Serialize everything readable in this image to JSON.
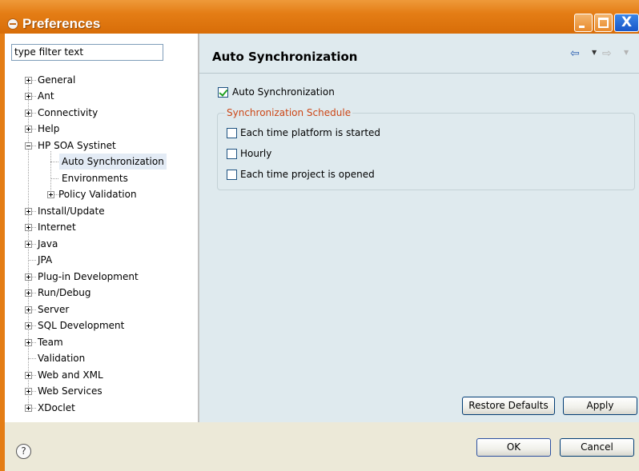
{
  "window": {
    "title": "Preferences",
    "minimize_glyph": "_",
    "maximize_glyph": "□",
    "close_glyph": "X",
    "accent_color": "#e47d15"
  },
  "filter": {
    "value": "type filter text"
  },
  "tree": {
    "items": [
      {
        "label": "General"
      },
      {
        "label": "Ant"
      },
      {
        "label": "Connectivity"
      },
      {
        "label": "Help"
      },
      {
        "label": "HP SOA Systinet"
      },
      {
        "label": "Auto Synchronization"
      },
      {
        "label": "Environments"
      },
      {
        "label": "Policy Validation"
      },
      {
        "label": "Install/Update"
      },
      {
        "label": "Internet"
      },
      {
        "label": "Java"
      },
      {
        "label": "JPA"
      },
      {
        "label": "Plug-in Development"
      },
      {
        "label": "Run/Debug"
      },
      {
        "label": "Server"
      },
      {
        "label": "SQL Development"
      },
      {
        "label": "Team"
      },
      {
        "label": "Validation"
      },
      {
        "label": "Web and XML"
      },
      {
        "label": "Web Services"
      },
      {
        "label": "XDoclet"
      }
    ],
    "selected": "Auto Synchronization"
  },
  "page": {
    "title": "Auto Synchronization",
    "back_icon": "back-arrow-icon",
    "forward_icon": "forward-arrow-icon",
    "auto_sync_label": "Auto Synchronization",
    "auto_sync_checked": true,
    "schedule_group_label": "Synchronization Schedule",
    "schedule_options": [
      {
        "label": "Each time platform is started",
        "checked": false
      },
      {
        "label": "Hourly",
        "checked": false
      },
      {
        "label": "Each time project is opened",
        "checked": false
      }
    ],
    "restore_defaults_label": "Restore Defaults",
    "apply_label": "Apply"
  },
  "footer": {
    "help_glyph": "?",
    "ok_label": "OK",
    "cancel_label": "Cancel"
  }
}
